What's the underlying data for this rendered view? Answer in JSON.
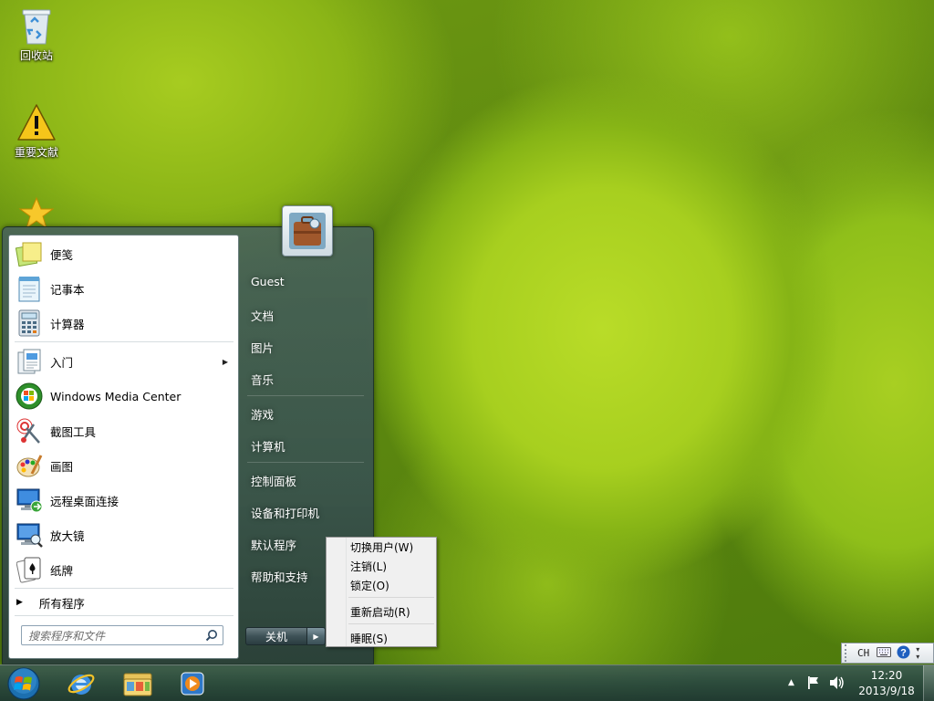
{
  "desktop": {
    "icons": [
      {
        "label": "回收站",
        "icon": "recycle-bin-icon"
      },
      {
        "label": "重要文献",
        "icon": "warning-icon"
      },
      {
        "label": "",
        "icon": "star-icon"
      }
    ]
  },
  "start_menu": {
    "pinned": [
      {
        "label": "便笺",
        "icon": "sticky-notes-icon"
      },
      {
        "label": "记事本",
        "icon": "notepad-icon"
      },
      {
        "label": "计算器",
        "icon": "calculator-icon"
      }
    ],
    "recent": [
      {
        "label": "入门",
        "icon": "getting-started-icon",
        "has_submenu": true
      },
      {
        "label": "Windows Media Center",
        "icon": "media-center-icon"
      },
      {
        "label": "截图工具",
        "icon": "snipping-tool-icon"
      },
      {
        "label": "画图",
        "icon": "paint-icon"
      },
      {
        "label": "远程桌面连接",
        "icon": "remote-desktop-icon"
      },
      {
        "label": "放大镜",
        "icon": "magnifier-icon"
      },
      {
        "label": "纸牌",
        "icon": "solitaire-icon"
      }
    ],
    "all_programs": "所有程序",
    "search_placeholder": "搜索程序和文件",
    "right_column": [
      {
        "label": "Guest"
      },
      {
        "label": "文档"
      },
      {
        "label": "图片"
      },
      {
        "label": "音乐"
      },
      {
        "label": "游戏"
      },
      {
        "label": "计算机"
      },
      {
        "label": "控制面板"
      },
      {
        "label": "设备和打印机"
      },
      {
        "label": "默认程序"
      },
      {
        "label": "帮助和支持"
      }
    ],
    "shutdown_label": "关机"
  },
  "power_menu": {
    "items": [
      {
        "label": "切换用户(W)"
      },
      {
        "label": "注销(L)"
      },
      {
        "label": "锁定(O)"
      },
      {
        "label": "重新启动(R)"
      },
      {
        "label": "睡眠(S)"
      }
    ]
  },
  "language_bar": {
    "lang": "CH"
  },
  "taskbar": {
    "pinned": [
      {
        "name": "internet-explorer-icon"
      },
      {
        "name": "windows-explorer-icon"
      },
      {
        "name": "media-player-icon"
      }
    ],
    "clock_time": "12:20",
    "clock_date": "2013/9/18"
  },
  "colors": {
    "wallpaper_green": "#a7cf1f",
    "start_menu_glass": "#415e5e",
    "taskbar": "#2e4c48"
  }
}
